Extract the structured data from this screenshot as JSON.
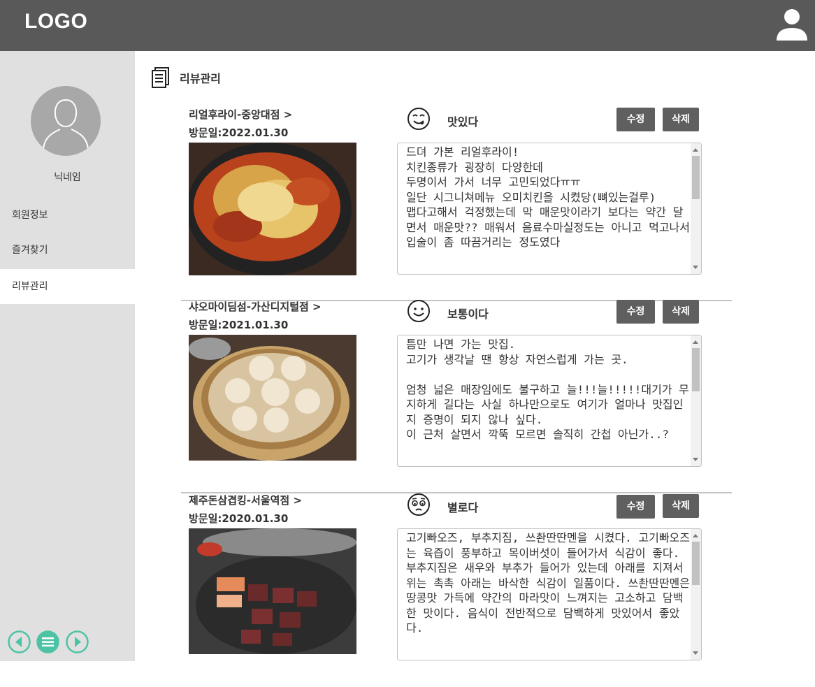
{
  "header": {
    "logo": "LOGO",
    "user_icon": "user-icon"
  },
  "sidebar": {
    "nickname": "닉네임",
    "menu": [
      {
        "label": "회원정보",
        "active": false
      },
      {
        "label": "즐겨찾기",
        "active": false
      },
      {
        "label": "리뷰관리",
        "active": true
      }
    ],
    "bottom_nav": [
      "prev-icon",
      "menu-icon",
      "next-icon"
    ]
  },
  "main": {
    "section_title": "리뷰관리",
    "reviews": [
      {
        "store": "리얼후라이-중앙대점  >",
        "visit": "방문일:2022.01.30",
        "mood": "맛있다",
        "mood_icon": "yummy-face-icon",
        "edit_label": "수정",
        "delete_label": "삭제",
        "text": "드뎌 가본 리얼후라이!\n치킨종류가 굉장히 다양한데\n두명이서 가서 너무 고민되었다ㅠㅠ\n일단 시그니쳐메뉴 오미치킨을 시켰당(뼈있는걸루)\n맵다고해서 걱정했는데 막 매운맛이라기 보다는 약간 달면서 매운맛?? 매워서 음료수마실정도는 아니고 먹고나서 입술이 좀 따끔거리는 정도였다"
      },
      {
        "store": "샤오마이딤섬-가산디지털점  >",
        "visit": "방문일:2021.01.30",
        "mood": "보통이다",
        "mood_icon": "smile-face-icon",
        "edit_label": "수정",
        "delete_label": "삭제",
        "text": "틈만 나면 가는 맛집.\n고기가 생각날 땐 항상 자연스럽게 가는 곳.\n\n엄청 넓은 매장임에도 불구하고 늘!!!늘!!!!!대기가 무지하게 길다는 사실 하나만으로도 여기가 얼마나 맛집인지 증명이 되지 않나 싶다.\n이 근처 살면서 깍뚝 모르면 솔직히 간첩 아닌가..?"
      },
      {
        "store": "제주돈삼겹킹-서울역점  >",
        "visit": "방문일:2020.01.30",
        "mood": "별로다",
        "mood_icon": "meh-face-icon",
        "edit_label": "수정",
        "delete_label": "삭제",
        "text": "고기빠오즈, 부추지짐, 쓰촨딴딴멘을 시켰다. 고기빠오즈는 육즙이 풍부하고 목이버섯이 들어가서 식감이 좋다. 부추지짐은 새우와 부추가 들어가 있는데 아래를 지져서 위는 촉촉 아래는 바삭한 식감이 일품이다. 쓰촨딴딴멘은 땅콩맛 가득에 약간의 마라맛이 느껴지는 고소하고 담백한 맛이다. 음식이 전반적으로 담백하게 맛있어서 좋았다."
      }
    ]
  }
}
